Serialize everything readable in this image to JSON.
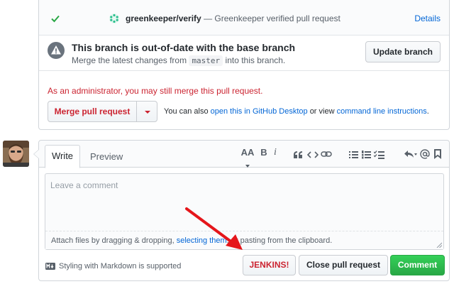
{
  "status_check": {
    "name": "greenkeeper/verify",
    "description": "— Greenkeeper verified pull request",
    "details_link": "Details"
  },
  "outdated": {
    "title": "This branch is out-of-date with the base branch",
    "sub_prefix": "Merge the latest changes from",
    "base_branch": "master",
    "sub_suffix": "into this branch.",
    "update_button": "Update branch"
  },
  "merge": {
    "admin_notice": "As an administrator, you may still merge this pull request.",
    "merge_button": "Merge pull request",
    "help_prefix": "You can also",
    "desktop_link": "open this in GitHub Desktop",
    "help_middle": "or view",
    "cli_link": "command line instructions",
    "help_suffix": "."
  },
  "comment": {
    "tabs": {
      "write": "Write",
      "preview": "Preview"
    },
    "toolbar": {
      "heading": "AA",
      "bold": "B",
      "italic": "i"
    },
    "placeholder": "Leave a comment",
    "attach_prefix": "Attach files by dragging & dropping,",
    "attach_link": "selecting them",
    "attach_suffix": ", or pasting from the clipboard.",
    "markdown_note": "Styling with Markdown is supported",
    "buttons": {
      "jenkins": "JENKINS!",
      "close": "Close pull request",
      "comment": "Comment"
    }
  },
  "colors": {
    "success": "#28a745",
    "danger": "#cb2431",
    "link": "#0366d6",
    "annotation_arrow": "#e5161b"
  }
}
